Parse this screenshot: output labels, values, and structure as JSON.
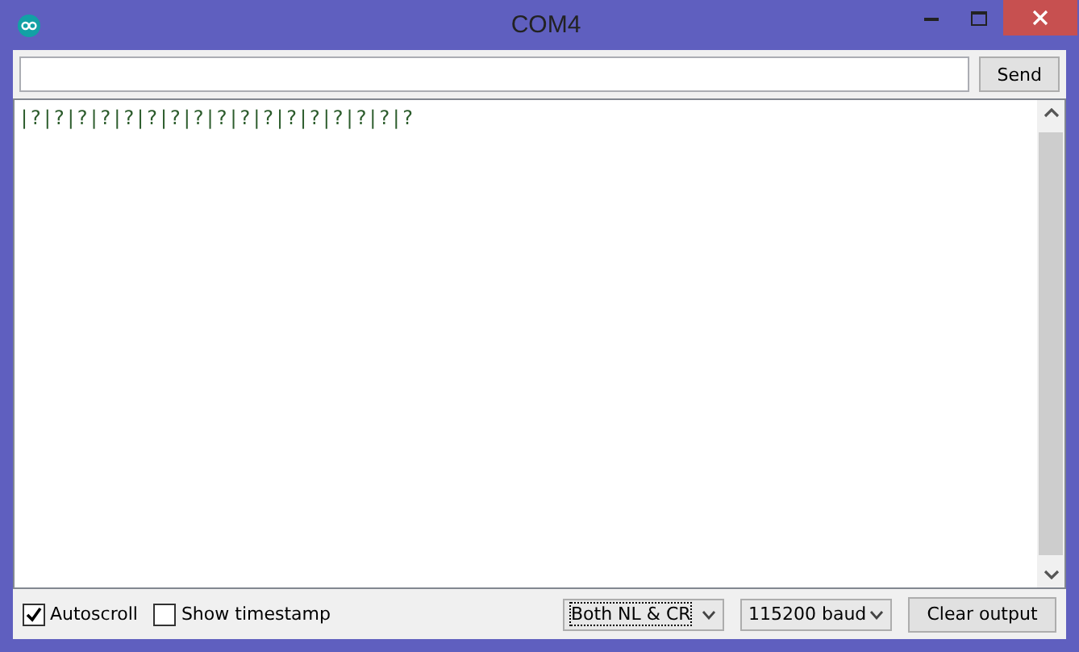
{
  "window": {
    "title": "COM4"
  },
  "send": {
    "button": "Send"
  },
  "output": {
    "text": "|?|?|?|?|?|?|?|?|?|?|?|?|?|?|?|?|?"
  },
  "options": [
    {
      "label": "Autoscroll",
      "checked": true
    },
    {
      "label": "Show timestamp",
      "checked": false
    }
  ],
  "line_ending": "Both NL & CR",
  "baud": "115200 baud",
  "clear": "Clear output"
}
